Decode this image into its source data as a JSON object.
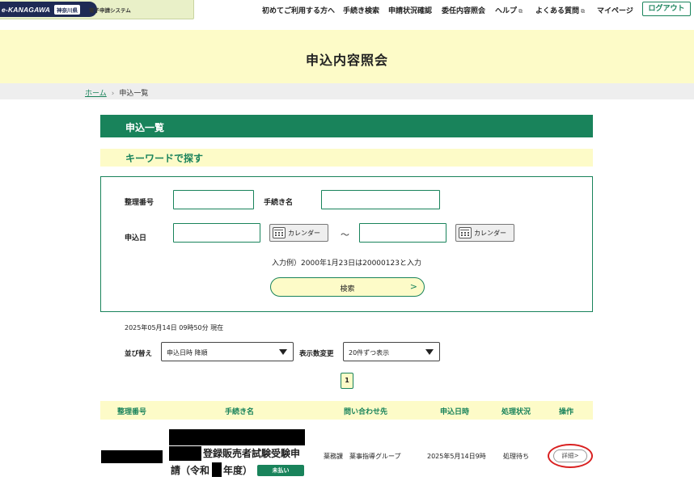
{
  "header": {
    "logo_text": "e-KANAGAWA",
    "logo_pref": "神奈川県",
    "logo_system": "電子申請システム",
    "nav": [
      {
        "label": "初めてご利用する方へ",
        "external": false
      },
      {
        "label": "手続き検索",
        "external": false
      },
      {
        "label": "申請状況確認",
        "external": false
      },
      {
        "label": "委任内容照会",
        "external": false
      },
      {
        "label": "ヘルプ",
        "external": true
      },
      {
        "label": "よくある質問",
        "external": true
      },
      {
        "label": "マイページ",
        "external": false
      }
    ],
    "external_mark": "⧉",
    "logout_label": "ログアウト"
  },
  "page_title": "申込内容照会",
  "breadcrumb": {
    "home": "ホーム",
    "separator": "›",
    "current": "申込一覧"
  },
  "section_title": "申込一覧",
  "search": {
    "heading": "キーワードで探す",
    "reference_label": "整理番号",
    "reference_value": "",
    "procedure_label": "手続き名",
    "procedure_value": "",
    "date_label": "申込日",
    "date_from": "",
    "date_to": "",
    "calendar_label": "カレンダー",
    "range_sep": "～",
    "example": "入力例）2000年1月23日は20000123と入力",
    "search_label": "検索",
    "search_arrow": ">"
  },
  "timestamp": "2025年05月14日 09時50分 現在",
  "sort": {
    "label": "並び替え",
    "value": "申込日時 降順"
  },
  "per_page": {
    "label": "表示数変更",
    "value": "20件ずつ表示"
  },
  "pagination": {
    "current": "1"
  },
  "table": {
    "headers": [
      "整理番号",
      "手続き名",
      "問い合わせ先",
      "申込日時",
      "処理状況",
      "操作"
    ],
    "rows": [
      {
        "procedure_line1": "登録販売者試験受験申",
        "procedure_line2_a": "請（令和",
        "procedure_line2_b": "年度）",
        "badge": "未払い",
        "contact": "薬務課　薬事指導グループ",
        "date": "2025年5月14日9時",
        "status": "処理待ち",
        "action": "詳細>"
      }
    ]
  },
  "colors": {
    "accent": "#19835b",
    "band": "#fdfbc8",
    "highlight_circle": "#d92020"
  }
}
